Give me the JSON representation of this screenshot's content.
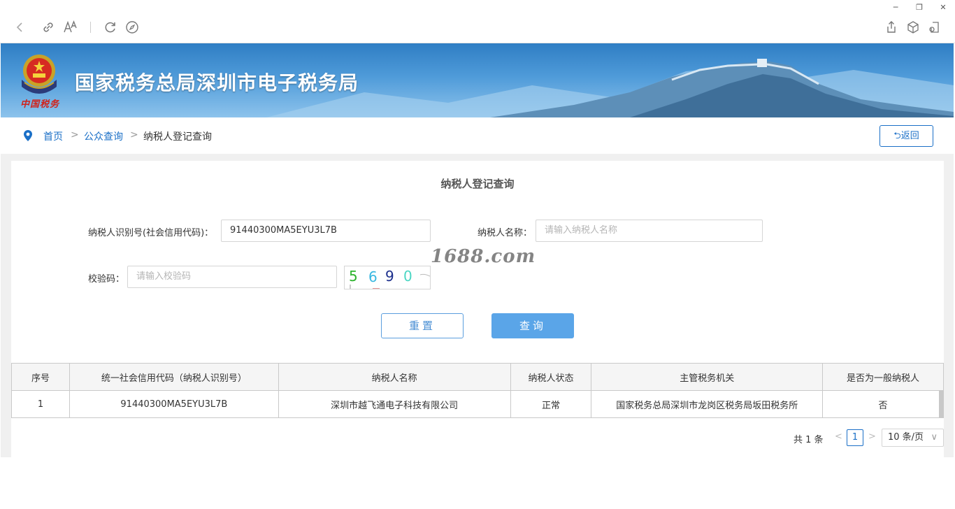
{
  "browser": {
    "icons": [
      "back-icon",
      "link-icon",
      "font-size-icon",
      "refresh-icon",
      "compass-icon",
      "share-icon",
      "cube-icon",
      "extension-icon"
    ],
    "window_controls": [
      "minimize-icon",
      "restore-icon",
      "close-icon"
    ],
    "minimize": "─",
    "restore": "❐",
    "close": "✕"
  },
  "banner": {
    "title": "国家税务总局深圳市电子税务局",
    "brand_script": "中国税务"
  },
  "breadcrumb": {
    "home": "首页",
    "sep": ">",
    "public_query": "公众查询",
    "current": "纳税人登记查询"
  },
  "back_button": "⮌返回",
  "panel": {
    "title": "纳税人登记查询",
    "taxpayer_id_label": "纳税人识别号(社会信用代码)：",
    "taxpayer_id_value": "91440300MA5EYU3L7B",
    "taxpayer_name_label": "纳税人名称：",
    "taxpayer_name_placeholder": "请输入纳税人名称",
    "captcha_label": "校验码：",
    "captcha_placeholder": "请输入校验码",
    "captcha_digits": [
      "5",
      "6",
      "9",
      "0"
    ],
    "captcha_colors": [
      "#2db32d",
      "#38b7e0",
      "#1c2f8c",
      "#4bd6c3"
    ],
    "reset_button": "重置",
    "query_button": "查询",
    "watermark": "1688.com"
  },
  "table": {
    "headers": [
      "序号",
      "统一社会信用代码（纳税人识别号）",
      "纳税人名称",
      "纳税人状态",
      "主管税务机关",
      "是否为一般纳税人"
    ],
    "rows": [
      [
        "1",
        "91440300MA5EYU3L7B",
        "深圳市越飞通电子科技有限公司",
        "正常",
        "国家税务总局深圳市龙岗区税务局坂田税务所",
        "否"
      ]
    ]
  },
  "pager": {
    "total": "共 1 条",
    "prev": "<",
    "next": ">",
    "page": "1",
    "page_size": "10 条/页",
    "chevron": "∨"
  },
  "colors": {
    "accent": "#1a6fc7",
    "query_button": "#5aa5e8",
    "banner_top": "#2f7ec4",
    "banner_bottom": "#8dc3ec"
  }
}
